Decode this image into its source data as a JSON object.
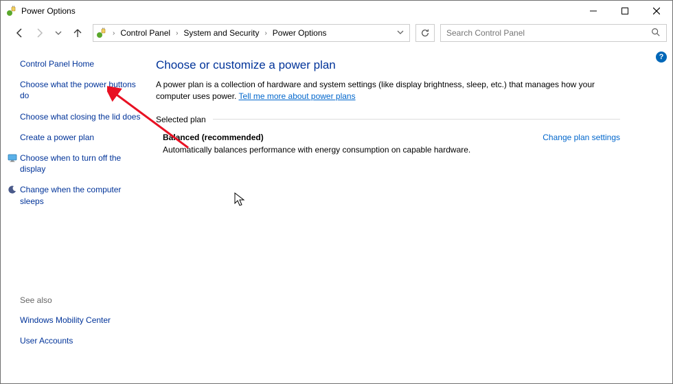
{
  "window": {
    "title": "Power Options"
  },
  "breadcrumb": {
    "items": [
      "Control Panel",
      "System and Security",
      "Power Options"
    ]
  },
  "search": {
    "placeholder": "Search Control Panel"
  },
  "sidebar": {
    "home": "Control Panel Home",
    "links": [
      {
        "label": "Choose what the power buttons do",
        "icon": null
      },
      {
        "label": "Choose what closing the lid does",
        "icon": null
      },
      {
        "label": "Create a power plan",
        "icon": null
      },
      {
        "label": "Choose when to turn off the display",
        "icon": "monitor-icon"
      },
      {
        "label": "Change when the computer sleeps",
        "icon": "moon-icon"
      }
    ],
    "see_also_title": "See also",
    "see_also": [
      {
        "label": "Windows Mobility Center"
      },
      {
        "label": "User Accounts"
      }
    ]
  },
  "main": {
    "heading": "Choose or customize a power plan",
    "description": "A power plan is a collection of hardware and system settings (like display brightness, sleep, etc.) that manages how your computer uses power. ",
    "description_link": "Tell me more about power plans",
    "section_label": "Selected plan",
    "plan": {
      "name": "Balanced (recommended)",
      "desc": "Automatically balances performance with energy consumption on capable hardware.",
      "action": "Change plan settings"
    }
  }
}
